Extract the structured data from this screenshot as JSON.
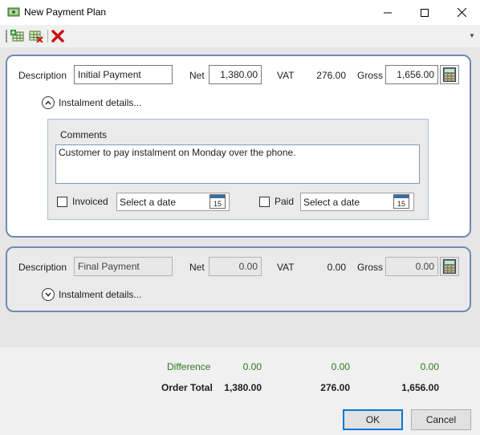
{
  "window": {
    "title": "New Payment Plan",
    "icon": "payment-plan-icon",
    "controls": {
      "minimize": "minimize-icon",
      "maximize": "maximize-icon",
      "close": "close-icon"
    }
  },
  "toolbar": {
    "items": [
      {
        "name": "add-instalment",
        "icon": "add-grid-icon"
      },
      {
        "name": "remove-instalment",
        "icon": "remove-grid-icon"
      },
      {
        "name": "delete",
        "icon": "red-x-icon"
      }
    ]
  },
  "instalments": [
    {
      "description_label": "Description",
      "description": "Initial Payment",
      "net_label": "Net",
      "net": "1,380.00",
      "vat_label": "VAT",
      "vat": "276.00",
      "gross_label": "Gross",
      "gross": "1,656.00",
      "expander_label": "Instalment details...",
      "expanded": true,
      "comments_label": "Comments",
      "comments": "Customer to pay instalment on Monday over the phone.",
      "invoiced_label": "Invoiced",
      "invoiced_date_placeholder": "Select a date",
      "paid_label": "Paid",
      "paid_date_placeholder": "Select a date",
      "calendar_day": "15"
    },
    {
      "description_label": "Description",
      "description": "Final Payment",
      "net_label": "Net",
      "net": "0.00",
      "vat_label": "VAT",
      "vat": "0.00",
      "gross_label": "Gross",
      "gross": "0.00",
      "expander_label": "Instalment details...",
      "expanded": false
    }
  ],
  "summary": {
    "difference_label": "Difference",
    "difference_net": "0.00",
    "difference_vat": "0.00",
    "difference_gross": "0.00",
    "total_label": "Order Total",
    "total_net": "1,380.00",
    "total_vat": "276.00",
    "total_gross": "1,656.00"
  },
  "buttons": {
    "ok": "OK",
    "cancel": "Cancel"
  },
  "colors": {
    "card_border": "#6e8cb0",
    "difference_text": "#2d7a1e",
    "delete_icon": "#d01010",
    "default_button_border": "#0078d7"
  }
}
